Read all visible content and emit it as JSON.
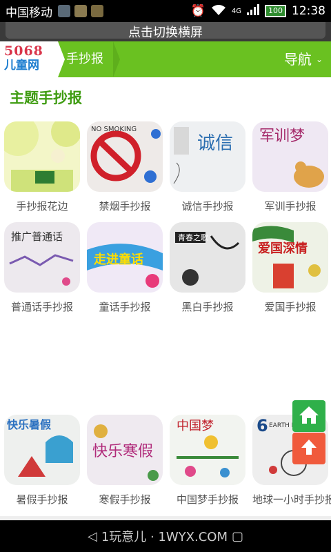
{
  "status_bar": {
    "carrier": "中国移动",
    "network": "4G",
    "battery": "100",
    "time": "12:38"
  },
  "hint": {
    "text": "点击切换横屏"
  },
  "navbar": {
    "logo_line1": "5068",
    "logo_line2": "儿童网",
    "breadcrumb": "手抄报",
    "menu_label": "导航"
  },
  "section_title": "主题手抄报",
  "rows": [
    {
      "items": [
        {
          "label": "手抄报花边",
          "icon": "floral-border-thumbnail"
        },
        {
          "label": "禁烟手抄报",
          "icon": "no-smoking-thumbnail",
          "art_text": "NO SMOKING"
        },
        {
          "label": "诚信手抄报",
          "icon": "honesty-thumbnail",
          "art_text": "诚信"
        },
        {
          "label": "军训手抄报",
          "icon": "military-training-thumbnail",
          "art_text": "军训梦"
        }
      ]
    },
    {
      "items": [
        {
          "label": "普通话手抄报",
          "icon": "mandarin-thumbnail",
          "art_text": "推广普通话"
        },
        {
          "label": "童话手抄报",
          "icon": "fairy-tale-thumbnail",
          "art_text": "走进童话"
        },
        {
          "label": "黑白手抄报",
          "icon": "black-white-thumbnail",
          "art_text": "青春之歌"
        },
        {
          "label": "爱国手抄报",
          "icon": "patriotic-thumbnail",
          "art_text": "爱国深情"
        }
      ]
    },
    {
      "items": [
        {
          "label": "暑假手抄报",
          "icon": "summer-vacation-thumbnail",
          "art_text": "快乐暑假"
        },
        {
          "label": "寒假手抄报",
          "icon": "winter-vacation-thumbnail",
          "art_text": "快乐寒假"
        },
        {
          "label": "中国梦手抄报",
          "icon": "china-dream-thumbnail",
          "art_text": "中国梦"
        },
        {
          "label": "地球一小时手抄报",
          "icon": "earth-hour-thumbnail",
          "art_text": "EARTH HOUR"
        }
      ]
    }
  ],
  "fabs": {
    "home": "home-icon",
    "up": "scroll-top-icon"
  },
  "system_bar": {
    "watermark": "1玩意儿 · 1WYX.COM"
  },
  "colors": {
    "brand_green": "#6ac121",
    "title_green": "#3f9c12",
    "fab_green": "#2fb04a",
    "fab_red": "#f05a3c"
  }
}
